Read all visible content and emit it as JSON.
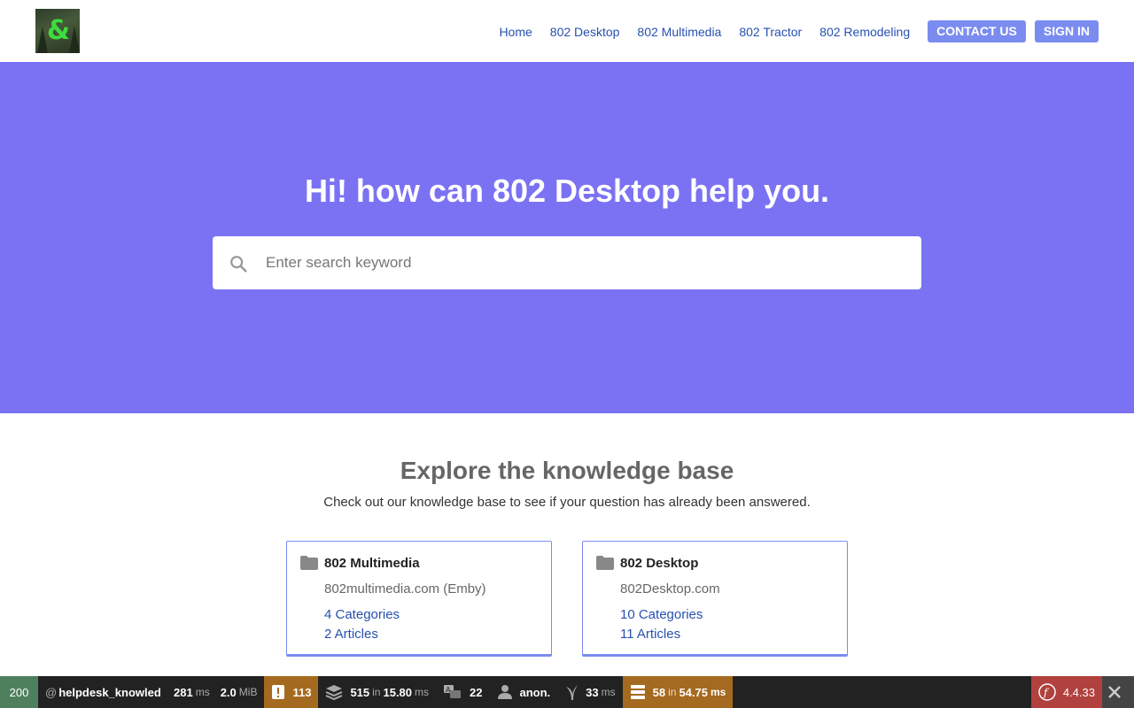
{
  "header": {
    "logo_alt": "802 Desktop logo",
    "nav": [
      {
        "label": "Home"
      },
      {
        "label": "802 Desktop"
      },
      {
        "label": "802 Multimedia"
      },
      {
        "label": "802 Tractor"
      },
      {
        "label": "802 Remodeling"
      }
    ],
    "contact_label": "CONTACT US",
    "signin_label": "SIGN IN"
  },
  "hero": {
    "title": "Hi! how can 802 Desktop help you.",
    "search_placeholder": "Enter search keyword",
    "search_value": ""
  },
  "knowledge_base": {
    "title": "Explore the knowledge base",
    "subtitle": "Check out our knowledge base to see if your question has already been answered.",
    "cards": [
      {
        "title": "802 Multimedia",
        "description": "802multimedia.com (Emby)",
        "categories": "4 Categories",
        "articles": "2 Articles"
      },
      {
        "title": "802 Desktop",
        "description": "802Desktop.com",
        "categories": "10 Categories",
        "articles": "11 Articles"
      }
    ]
  },
  "toolbar": {
    "status": "200",
    "route": "helpdesk_knowled",
    "time_value": "281",
    "time_unit": "ms",
    "memory_value": "2.0",
    "memory_unit": "MiB",
    "warnings": "113",
    "cache_count": "515",
    "cache_in": "in",
    "cache_time": "15.80",
    "cache_unit": "ms",
    "translations": "22",
    "user": "anon.",
    "render_time": "33",
    "render_unit": "ms",
    "db_queries": "58",
    "db_in": "in",
    "db_time": "54.75",
    "db_unit": "ms",
    "version": "4.4.33"
  },
  "colors": {
    "hero_bg": "#7b72f3",
    "accent_button": "#7b8cf0",
    "link": "#2750b0",
    "toolbar_bg": "#222222",
    "status_ok": "#4f805d",
    "warning": "#a46a1f",
    "version_bg": "#b0413e"
  },
  "icons": [
    "logo",
    "search-icon",
    "folder-icon",
    "exclamation-icon",
    "layers-icon",
    "translation-icon",
    "user-icon",
    "leaf-icon",
    "database-icon",
    "symfony-icon",
    "close-icon"
  ]
}
